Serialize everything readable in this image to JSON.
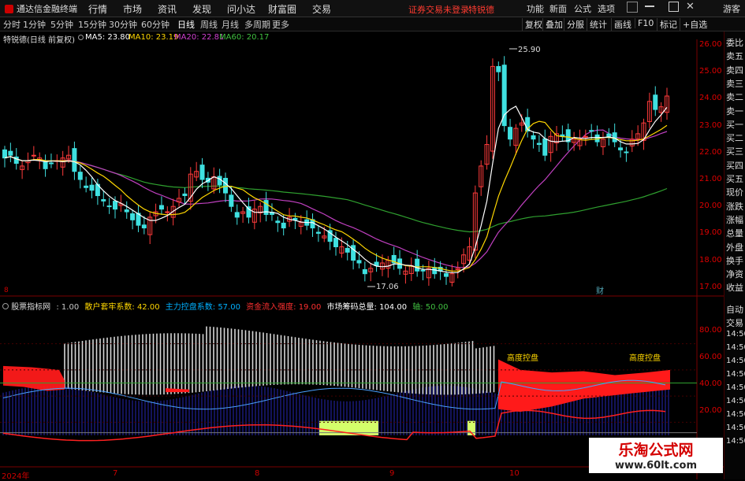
{
  "app": {
    "title": "通达信金融终端"
  },
  "menu": [
    "行情",
    "市场",
    "资讯",
    "发现",
    "问小达",
    "财富圈",
    "交易"
  ],
  "notice": {
    "login": "证券交易未登录",
    "stock": "特锐德"
  },
  "top_right": [
    "功能",
    "新面",
    "公式",
    "选项"
  ],
  "guest": "游客",
  "periods": [
    "分时",
    "1分钟",
    "5分钟",
    "15分钟",
    "30分钟",
    "60分钟",
    "日线",
    "周线",
    "月线",
    "多周期",
    "更多"
  ],
  "active_period": "日线",
  "toolbar_right": [
    "复权",
    "叠加",
    "分服",
    "统计",
    "画线",
    "F10",
    "标记",
    "+自选"
  ],
  "main_chart": {
    "title": "特锐德(日线 前复权)",
    "ma": [
      {
        "label": "MA5: 23.80",
        "color": "#ffffff"
      },
      {
        "label": "MA10: 23.19",
        "color": "#ffd700"
      },
      {
        "label": "MA20: 22.81",
        "color": "#d040d0"
      },
      {
        "label": "MA60: 20.17",
        "color": "#40c040"
      }
    ],
    "yticks": [
      "26.00",
      "25.00",
      "24.00",
      "23.00",
      "22.00",
      "21.00",
      "20.00",
      "19.00",
      "18.00",
      "17.00"
    ],
    "high_label": "25.90",
    "low_label": "17.06",
    "date_marks": [
      "财"
    ]
  },
  "indicator": {
    "name": "股票指标网",
    "items": [
      {
        "label": ": 1.00",
        "color": "#c8c8c8"
      },
      {
        "label": "散户套牢系数: 42.00",
        "color": "#ffd700"
      },
      {
        "label": "主力控盘系数: 57.00",
        "color": "#00b0ff"
      },
      {
        "label": "资金流入强度: 19.00",
        "color": "#ff3030"
      },
      {
        "label": "市场筹码总量: 104.00",
        "color": "#ffffff"
      },
      {
        "label": "轴: 50.00",
        "color": "#40c040"
      }
    ],
    "yticks": [
      "80.00",
      "60.00",
      "40.00",
      "20.00"
    ],
    "annotations": [
      "高度控盘",
      "高度控盘"
    ]
  },
  "x_axis": [
    "2024年",
    "7",
    "8",
    "9",
    "10"
  ],
  "side_panel": {
    "top": [
      "委比",
      "卖五",
      "卖四",
      "卖三",
      "卖二",
      "卖一",
      "买一",
      "买二",
      "买三",
      "买四",
      "买五",
      "现价",
      "涨跌",
      "涨幅",
      "总量",
      "外盘",
      "换手",
      "净资",
      "收益"
    ],
    "bottom": [
      "自动",
      "交易",
      "14:50",
      "14:50",
      "14:50",
      "14:50",
      "14:50",
      "14:50",
      "14:50",
      "14:50",
      "14:50"
    ]
  },
  "watermark": {
    "title": "乐淘公式网",
    "url": "www.60lt.com"
  }
}
